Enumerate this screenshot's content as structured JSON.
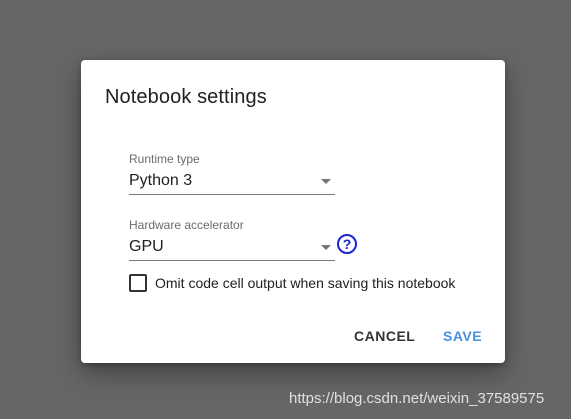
{
  "dialog": {
    "title": "Notebook settings",
    "runtime_type": {
      "label": "Runtime type",
      "value": "Python 3"
    },
    "hardware_accelerator": {
      "label": "Hardware accelerator",
      "value": "GPU"
    },
    "help_glyph": "?",
    "omit_output": {
      "label": "Omit code cell output when saving this notebook",
      "checked": false
    },
    "buttons": {
      "cancel_label": "CANCEL",
      "save_label": "SAVE"
    }
  },
  "watermark": "https://blog.csdn.net/weixin_37589575",
  "colors": {
    "overlay": "#666666",
    "save_accent": "#4a90e2",
    "help_icon": "#1a24d6"
  },
  "icons": {
    "dropdown": "chevron-down-icon",
    "help": "help-icon"
  }
}
